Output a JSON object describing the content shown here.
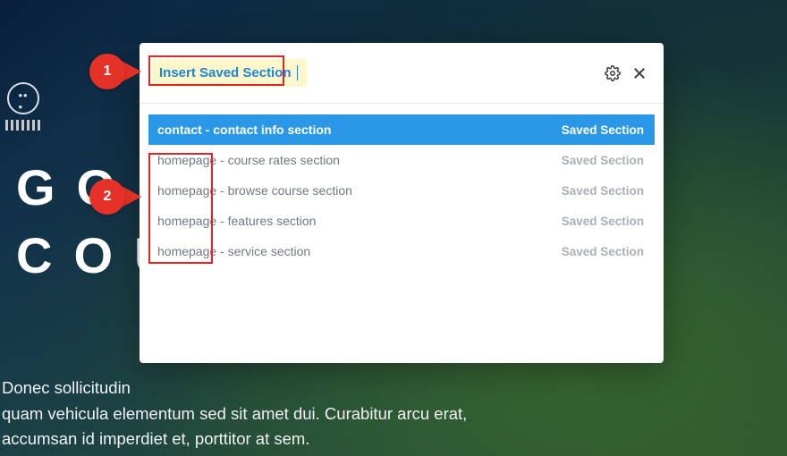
{
  "background": {
    "title_line1": "GOL",
    "title_line2": "COU",
    "paragraph": "Donec sollicitudin\nquam vehicula elementum sed sit amet dui. Curabitur arcu erat,\naccumsan id imperdiet et, porttitor at sem."
  },
  "modal": {
    "title": "Insert Saved Section",
    "items": [
      {
        "name": "contact - contact info section",
        "type": "Saved Section",
        "selected": true
      },
      {
        "name": "homepage - course rates section",
        "type": "Saved Section",
        "selected": false
      },
      {
        "name": "homepage - browse course section",
        "type": "Saved Section",
        "selected": false
      },
      {
        "name": "homepage - features section",
        "type": "Saved Section",
        "selected": false
      },
      {
        "name": "homepage - service section",
        "type": "Saved Section",
        "selected": false
      }
    ]
  },
  "callouts": {
    "one": "1",
    "two": "2"
  }
}
